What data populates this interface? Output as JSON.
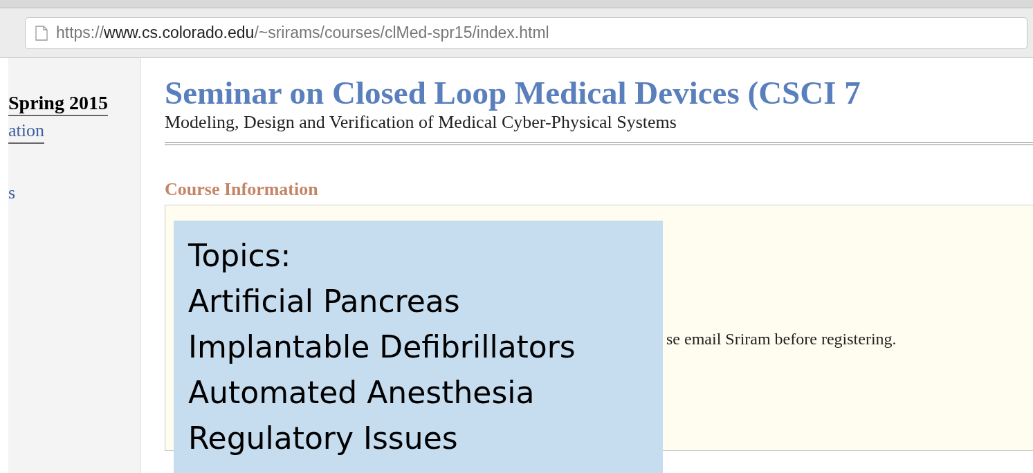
{
  "browser": {
    "url_host": "https://www.cs.colorado.edu",
    "url_path": "/~srirams/courses/clMed-spr15/index.html"
  },
  "sidebar": {
    "heading": "Spring 2015",
    "links": [
      "ation",
      "s"
    ]
  },
  "page": {
    "title": "Seminar on Closed Loop Medical Devices (CSCI 7",
    "subtitle": "Modeling, Design and Verification of Medical Cyber-Physical Systems",
    "section_heading": "Course Information",
    "info_text": "se email Sriram before registering."
  },
  "overlay": {
    "lines": [
      "Topics:",
      "Artificial Pancreas",
      "Implantable Defibrillators",
      "Automated Anesthesia",
      "Regulatory Issues"
    ]
  }
}
